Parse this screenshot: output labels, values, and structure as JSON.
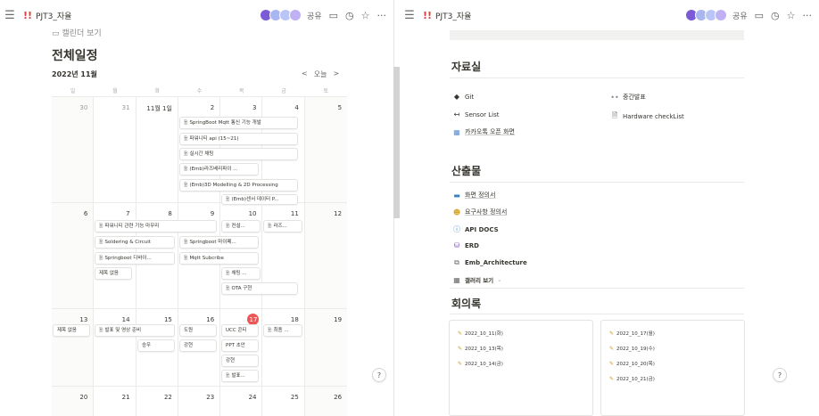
{
  "left_pane": {
    "window": {
      "title": "PJT3_자율",
      "share_label": "공유"
    },
    "breadcrumb_label": "캘린더 보기",
    "calendar": {
      "title": "전체일정",
      "month": "2022년 11월",
      "nav": {
        "prev": "<",
        "today": "오늘",
        "next": ">"
      },
      "weekdays": [
        "일",
        "월",
        "화",
        "수",
        "목",
        "금",
        "토"
      ],
      "weeks": [
        {
          "days": [
            "30",
            "31",
            "11월 1일",
            "2",
            "3",
            "4",
            "5"
          ],
          "events": [
            "SpringBoot Mqtt 통신 기능 개발",
            "파워니티 api (15~21)",
            "실시간 채팅",
            "(Emb)라즈베리파이 ...",
            "(Emb)3D Modelling & 2D Processing",
            "(Emb)센서 데이터 P..."
          ]
        },
        {
          "days": [
            "6",
            "7",
            "8",
            "9",
            "10",
            "11",
            "12"
          ],
          "events": [
            "파워니티 관련 기능 마무리",
            "컨설...",
            "라즈...",
            "Soldering & Circuit",
            "Springboot 마이페...",
            "Springboot 디바이...",
            "Mqtt Subcribe",
            "제목 없음",
            "채팅 ...",
            "OTA 구현"
          ]
        },
        {
          "days": [
            "13",
            "14",
            "15",
            "16",
            "17",
            "18",
            "19"
          ],
          "events": [
            "제목 없음",
            "발표 및 영상 준비",
            "도원",
            "UCC 콘티",
            "최종 ...",
            "승우",
            "강현",
            "PPT 초안",
            "강현",
            "발표..."
          ]
        },
        {
          "days": [
            "20",
            "21",
            "22",
            "23",
            "24",
            "25",
            "26"
          ]
        }
      ]
    }
  },
  "right_pane": {
    "window": {
      "title": "PJT3_자율",
      "share_label": "공유"
    },
    "resources": {
      "title": "자료실",
      "links": [
        {
          "label": "Git",
          "icon": "git-diamond-icon"
        },
        {
          "label": "중간발표",
          "icon": "dots-icon"
        },
        {
          "label": "Sensor List",
          "icon": "arrows-icon"
        },
        {
          "label": "Hardware checkList",
          "icon": "page-icon"
        },
        {
          "label": "카카오톡 오픈 화면",
          "icon": "image-icon"
        }
      ]
    },
    "outputs": {
      "title": "산출물",
      "links": [
        {
          "label": "화면 정의서",
          "icon": "monitor-icon"
        },
        {
          "label": "요구사항 정의서",
          "icon": "face-icon"
        },
        {
          "label": "API DOCS",
          "icon": "info-icon"
        },
        {
          "label": "ERD",
          "icon": "database-icon"
        },
        {
          "label": "Emb_Architecture",
          "icon": "diagram-icon"
        }
      ],
      "gallery_view_label": "갤러리 보기"
    },
    "meetings": {
      "title": "회의록",
      "cards": [
        [
          "2022_10_11(화)",
          "2022_10_13(목)",
          "2022_10_14(금)"
        ],
        [
          "2022_10_17(월)",
          "2022_10_19(수)",
          "2022_10_20(목)",
          "2022_10_21(금)"
        ]
      ]
    }
  },
  "help_label": "?",
  "colors": {
    "today_red": "#eb5757",
    "accent_purple": "#7b5cd6",
    "border": "#e2e2e0"
  }
}
